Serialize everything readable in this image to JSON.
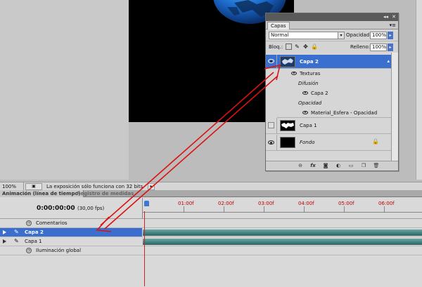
{
  "status_bar": {
    "zoom": "100%",
    "message": "La exposición sólo funciona con 32 bits"
  },
  "layers_panel": {
    "title_controls": "◂◂ ✕",
    "tab": "Capas",
    "menu_icon": "▾≡",
    "blend_mode": "Normal",
    "opacity_label": "Opacidad:",
    "opacity_value": "100%",
    "lock_label": "Bloq.:",
    "fill_label": "Relleno:",
    "fill_value": "100%",
    "layers": [
      {
        "name": "Capa 2",
        "visible": true,
        "selected": true
      },
      {
        "name": "Capa 1",
        "visible": false,
        "selected": false
      },
      {
        "name": "Fondo",
        "visible": true,
        "selected": false,
        "locked": true
      }
    ],
    "effects": {
      "texturas": "Texturas",
      "difusion": "Difusión",
      "difusion_item": "Capa 2",
      "opacidad": "Opacidad",
      "opacidad_item": "Material_Esfera - Opacidad"
    }
  },
  "animation_panel": {
    "tabs": [
      "Animación (línea de tiempo)",
      "Registro de medidas"
    ],
    "timecode": "0:00:00:00",
    "fps": "(30,00 fps)",
    "ruler_labels": [
      "01:00f",
      "02:00f",
      "03:00f",
      "04:00f",
      "05:00f",
      "06:00f"
    ],
    "tracks": {
      "comentarios": "Comentarios",
      "capa2": "Capa 2",
      "capa1": "Capa 1",
      "iluminacion": "Iluminación global"
    }
  },
  "colors": {
    "selection": "#3a6fcf",
    "annotation_arrow": "#dd1111",
    "track_bar": "#3f7f7d",
    "ruler_labels": "#bb0000"
  }
}
